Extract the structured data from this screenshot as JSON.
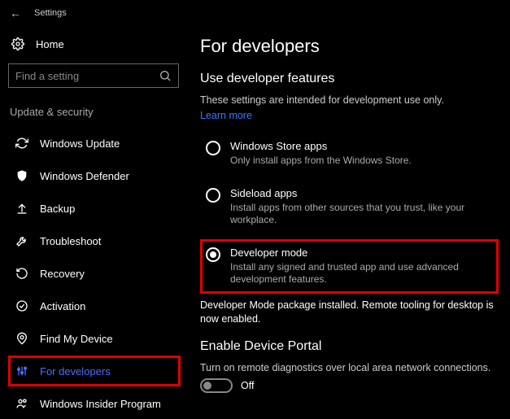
{
  "header": {
    "title": "Settings"
  },
  "sidebar": {
    "home": "Home",
    "search_placeholder": "Find a setting",
    "category": "Update & security",
    "items": [
      {
        "label": "Windows Update"
      },
      {
        "label": "Windows Defender"
      },
      {
        "label": "Backup"
      },
      {
        "label": "Troubleshoot"
      },
      {
        "label": "Recovery"
      },
      {
        "label": "Activation"
      },
      {
        "label": "Find My Device"
      },
      {
        "label": "For developers"
      },
      {
        "label": "Windows Insider Program"
      }
    ]
  },
  "main": {
    "page_title": "For developers",
    "section1": {
      "heading": "Use developer features",
      "intro": "These settings are intended for development use only.",
      "learn_more": "Learn more",
      "options": [
        {
          "label": "Windows Store apps",
          "desc": "Only install apps from the Windows Store.",
          "checked": false
        },
        {
          "label": "Sideload apps",
          "desc": "Install apps from other sources that you trust, like your workplace.",
          "checked": false
        },
        {
          "label": "Developer mode",
          "desc": "Install any signed and trusted app and use advanced development features.",
          "checked": true
        }
      ],
      "status": "Developer Mode package installed.  Remote tooling for desktop is now enabled."
    },
    "section2": {
      "heading": "Enable Device Portal",
      "desc": "Turn on remote diagnostics over local area network connections.",
      "toggle_state": "Off"
    }
  }
}
